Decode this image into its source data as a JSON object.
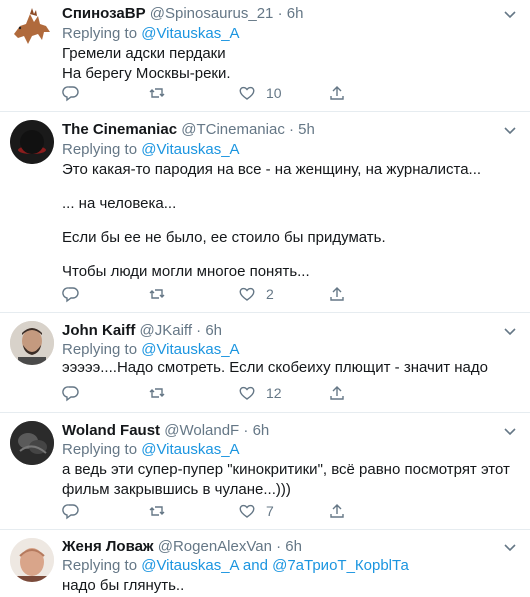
{
  "tweets": [
    {
      "name": "СпинозаВР",
      "handle": "@Spinosaurus_21",
      "dot": "·",
      "time": "6h",
      "reply_prefix": "Replying to",
      "mentions": [
        "@Vitauskas_A"
      ],
      "lines": [
        "Гремели адски пердаки",
        "На берегу Москвы-реки."
      ],
      "likes": "10"
    },
    {
      "name": "The Cinemaniac",
      "handle": "@TCinemaniac",
      "dot": "·",
      "time": "5h",
      "reply_prefix": "Replying to",
      "mentions": [
        "@Vitauskas_A"
      ],
      "lines": [
        "Это какая-то пародия на все - на женщину, на журналиста...",
        "",
        "... на человека...",
        "",
        "Если бы ее не было, ее стоило бы придумать.",
        "",
        "Чтобы люди могли многое понять..."
      ],
      "likes": "2"
    },
    {
      "name": "John Kaiff",
      "handle": "@JKaiff",
      "dot": "·",
      "time": "6h",
      "reply_prefix": "Replying to",
      "mentions": [
        "@Vitauskas_A"
      ],
      "lines": [
        "эээээ....Надо смотреть. Если скобеиху плющит - значит надо"
      ],
      "likes": "12"
    },
    {
      "name": "Woland Faust",
      "handle": "@WolandF",
      "dot": "·",
      "time": "6h",
      "reply_prefix": "Replying to",
      "mentions": [
        "@Vitauskas_A"
      ],
      "lines": [
        "а ведь эти супер-пупер \"кинокритики\", всё равно посмотрят этот",
        "фильм закрывшись в чулане...)))"
      ],
      "likes": "7"
    },
    {
      "name": "Женя Ловаж",
      "handle": "@RogenAlexVan",
      "dot": "·",
      "time": "6h",
      "reply_prefix": "Replying to",
      "mentions": [
        "@Vitauskas_A",
        "@7аТриоТ_КорblТа"
      ],
      "mention_joiner": "and",
      "lines": [
        "надо бы глянуть.."
      ],
      "likes": ""
    }
  ],
  "colors": {
    "link": "#1b95e0",
    "muted": "#657786",
    "text": "#14171a",
    "divider": "#e6ecf0"
  },
  "icons": [
    "chevron-down-icon",
    "reply-icon",
    "retweet-icon",
    "like-icon",
    "share-icon"
  ]
}
